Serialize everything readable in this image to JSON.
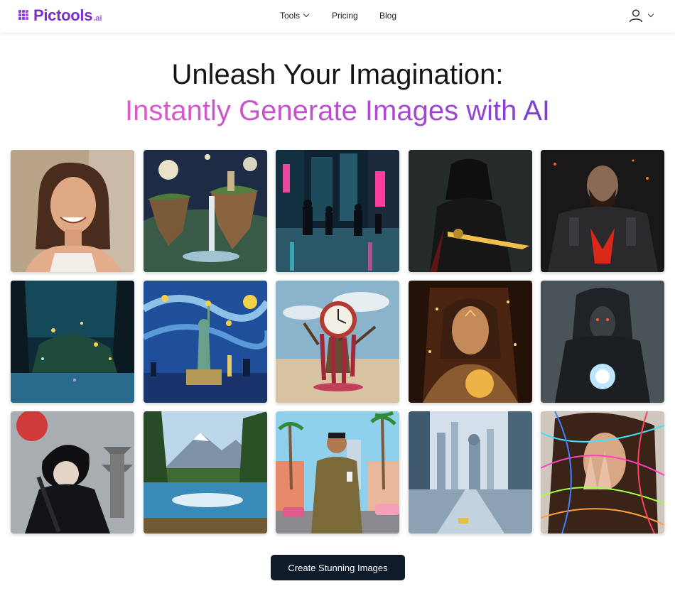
{
  "brand": {
    "name": "Pictools",
    "suffix": ".ai",
    "accent": "#7a2fc9"
  },
  "nav": {
    "items": [
      {
        "label": "Tools",
        "has_dropdown": true
      },
      {
        "label": "Pricing",
        "has_dropdown": false
      },
      {
        "label": "Blog",
        "has_dropdown": false
      }
    ]
  },
  "user_menu": {
    "icon": "user-icon",
    "dropdown_icon": "chevron-down-icon"
  },
  "hero": {
    "line1": "Unleash Your Imagination:",
    "line2": "Instantly Generate Images with AI",
    "gradient": [
      "#e05ac8",
      "#7a3fd4"
    ]
  },
  "gallery": [
    {
      "subject": "smiling-woman-portrait"
    },
    {
      "subject": "floating-islands-waterfall"
    },
    {
      "subject": "neon-city-street"
    },
    {
      "subject": "hooded-knight-glowing-sword"
    },
    {
      "subject": "armored-warrior-fire"
    },
    {
      "subject": "enchanted-forest-lights"
    },
    {
      "subject": "starry-night-statue-of-liberty"
    },
    {
      "subject": "melting-clock-desert"
    },
    {
      "subject": "golden-sparkle-portrait"
    },
    {
      "subject": "hooded-figure-crystal-orb"
    },
    {
      "subject": "anime-ninja-pagoda"
    },
    {
      "subject": "mountain-lake-pines"
    },
    {
      "subject": "gta-style-man-palms"
    },
    {
      "subject": "futuristic-city-canal"
    },
    {
      "subject": "woman-neon-light-strands"
    }
  ],
  "cta": {
    "label": "Create Stunning Images",
    "color": "#0f1b2b"
  }
}
